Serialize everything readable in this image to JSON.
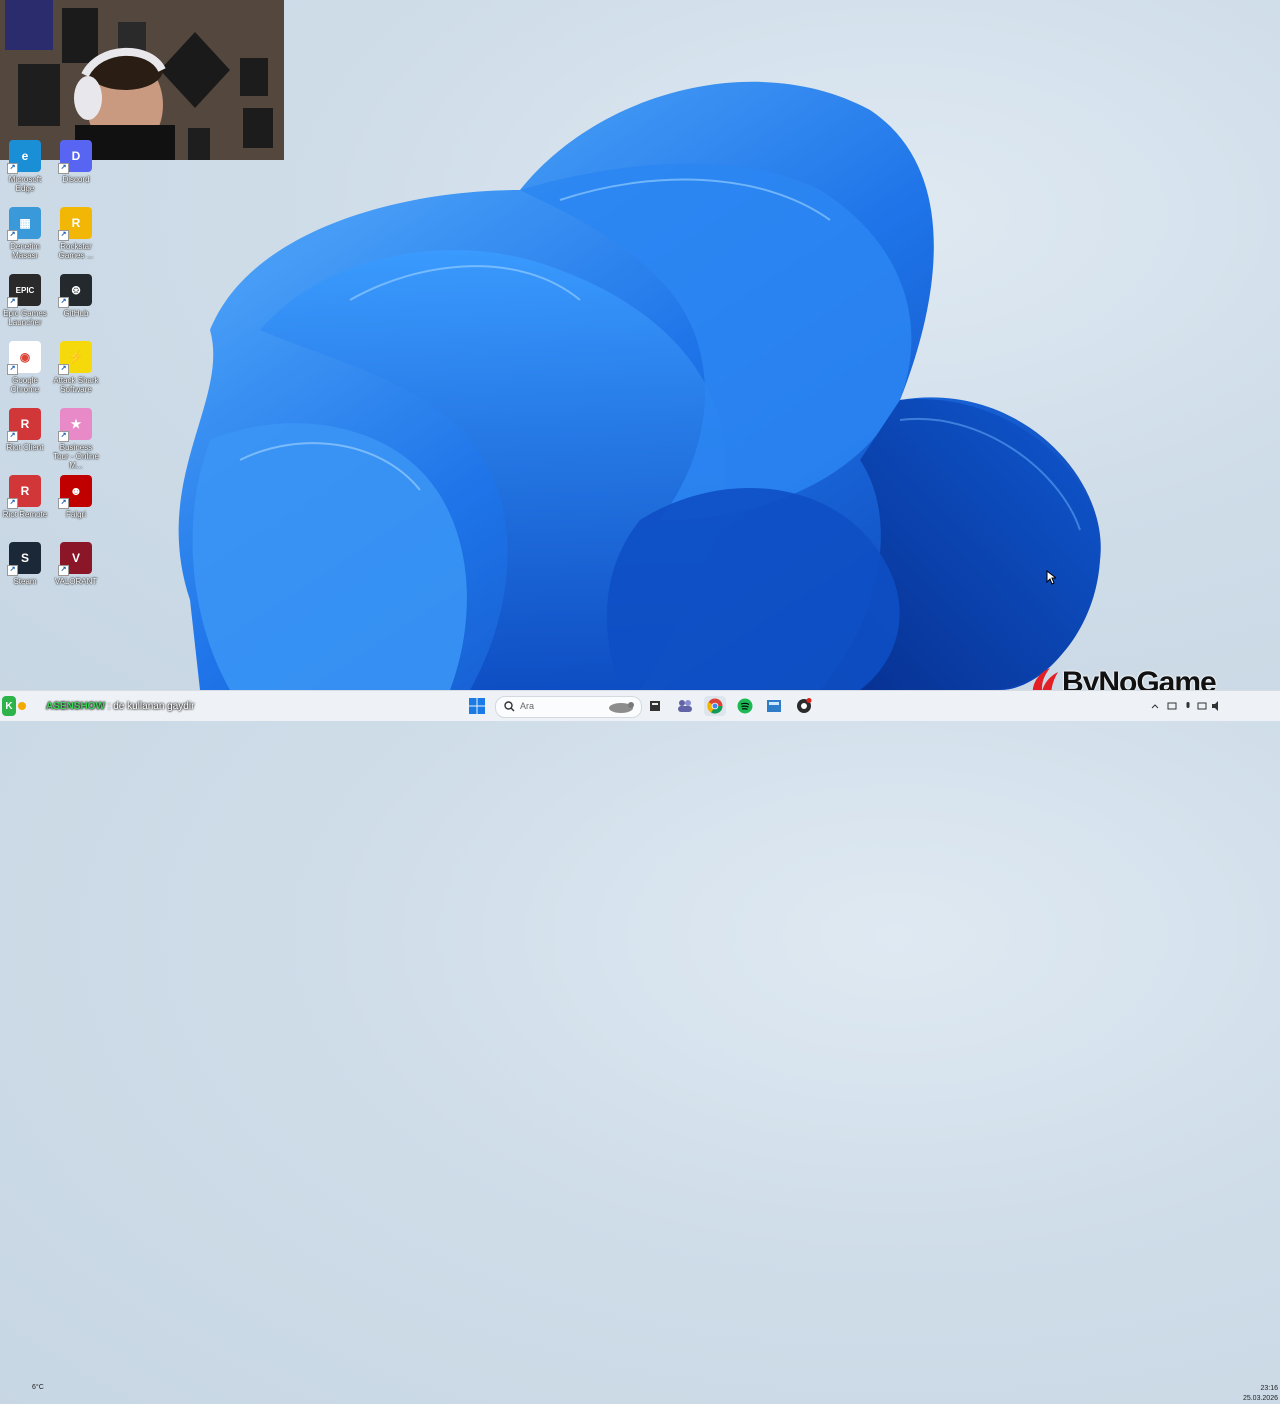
{
  "desktop": {
    "icons": [
      {
        "label": "Microsoft Edge",
        "color": "#1b8fd6",
        "glyph": "e"
      },
      {
        "label": "Discord",
        "color": "#5865f2",
        "glyph": "D"
      },
      {
        "label": "Denetim Masası",
        "color": "#3a9ad9",
        "glyph": "▦"
      },
      {
        "label": "Rockstar Games ...",
        "color": "#f2b705",
        "glyph": "R"
      },
      {
        "label": "Epic Games Launcher",
        "color": "#2a2a2a",
        "glyph": "EPIC"
      },
      {
        "label": "GitHub",
        "color": "#24292e",
        "glyph": "⊛"
      },
      {
        "label": "Google Chrome",
        "color": "#ffffff",
        "glyph": "◉"
      },
      {
        "label": "Attack Shark Software",
        "color": "#f5d90a",
        "glyph": "⚡"
      },
      {
        "label": "Riot Client",
        "color": "#d13639",
        "glyph": "R"
      },
      {
        "label": "Business Tour - Online M...",
        "color": "#e98ac8",
        "glyph": "★"
      },
      {
        "label": "Riot Remote",
        "color": "#d13639",
        "glyph": "R"
      },
      {
        "label": "Falgri",
        "color": "#c00000",
        "glyph": "☻"
      },
      {
        "label": "Steam",
        "color": "#1b2838",
        "glyph": "S"
      },
      {
        "label": "VALORANT",
        "color": "#8a1628",
        "glyph": "V"
      }
    ]
  },
  "overlay": {
    "name": "ASENSHOW",
    "message": ": de kullanan gaydir"
  },
  "taskbar": {
    "search_placeholder": "Ara",
    "weather": "6°C",
    "time": "23:16",
    "date": "25.03.2026"
  },
  "brand": {
    "text": "ByNoGame"
  },
  "colors": {
    "taskbar_bg": "#eef2f6",
    "wallpaper_blue": "#1a6fe0"
  }
}
